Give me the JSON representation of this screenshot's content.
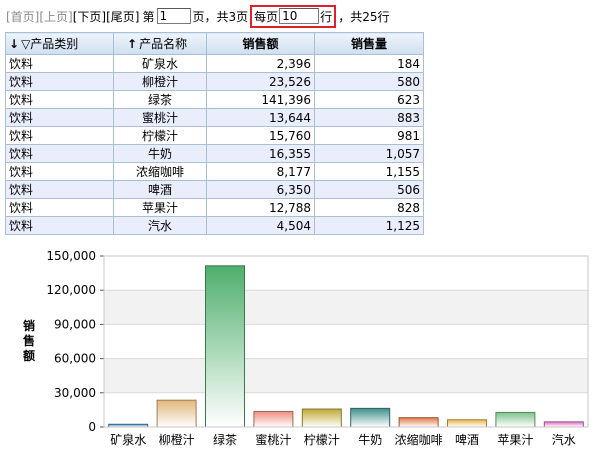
{
  "pager": {
    "first": "[首页]",
    "prev": "[上页]",
    "next": "[下页]",
    "last": "[尾页]",
    "page_prefix": "第",
    "page_value": "1",
    "page_suffix": "页，共3页",
    "per_prefix": "每页",
    "per_value": "10",
    "per_suffix": "行",
    "total": "，共25行"
  },
  "table": {
    "columns": [
      {
        "label": "产品类别",
        "sort_icon": "↓",
        "filter_icon": "▽"
      },
      {
        "label": "产品名称",
        "sort_icon": "↑"
      },
      {
        "label": "销售额"
      },
      {
        "label": "销售量"
      }
    ],
    "rows": [
      {
        "cat": "饮料",
        "name": "矿泉水",
        "amount": "2,396",
        "qty": "184"
      },
      {
        "cat": "饮料",
        "name": "柳橙汁",
        "amount": "23,526",
        "qty": "580"
      },
      {
        "cat": "饮料",
        "name": "绿茶",
        "amount": "141,396",
        "qty": "623"
      },
      {
        "cat": "饮料",
        "name": "蜜桃汁",
        "amount": "13,644",
        "qty": "883"
      },
      {
        "cat": "饮料",
        "name": "柠檬汁",
        "amount": "15,760",
        "qty": "981"
      },
      {
        "cat": "饮料",
        "name": "牛奶",
        "amount": "16,355",
        "qty": "1,057"
      },
      {
        "cat": "饮料",
        "name": "浓缩咖啡",
        "amount": "8,177",
        "qty": "1,155"
      },
      {
        "cat": "饮料",
        "name": "啤酒",
        "amount": "6,350",
        "qty": "506"
      },
      {
        "cat": "饮料",
        "name": "苹果汁",
        "amount": "12,788",
        "qty": "828"
      },
      {
        "cat": "饮料",
        "name": "汽水",
        "amount": "4,504",
        "qty": "1,125"
      }
    ]
  },
  "chart_data": {
    "type": "bar",
    "ylabel": "销售额",
    "ylim": [
      0,
      150000
    ],
    "yticks": [
      0,
      30000,
      60000,
      90000,
      120000,
      150000
    ],
    "ytick_labels": [
      "0",
      "30,000",
      "60,000",
      "90,000",
      "120,000",
      "150,000"
    ],
    "categories": [
      "矿泉水",
      "柳橙汁",
      "绿茶",
      "蜜桃汁",
      "柠檬汁",
      "牛奶",
      "浓缩咖啡",
      "啤酒",
      "苹果汁",
      "汽水"
    ],
    "values": [
      2396,
      23526,
      141396,
      13644,
      15760,
      16355,
      8177,
      6350,
      12788,
      4504
    ],
    "colors": [
      "#4a8fc8",
      "#e2b67a",
      "#4fae6c",
      "#ec8e7e",
      "#c0a838",
      "#3f8f8c",
      "#e07a45",
      "#e8b64a",
      "#7cc28a",
      "#e070c8"
    ],
    "grid": true
  }
}
